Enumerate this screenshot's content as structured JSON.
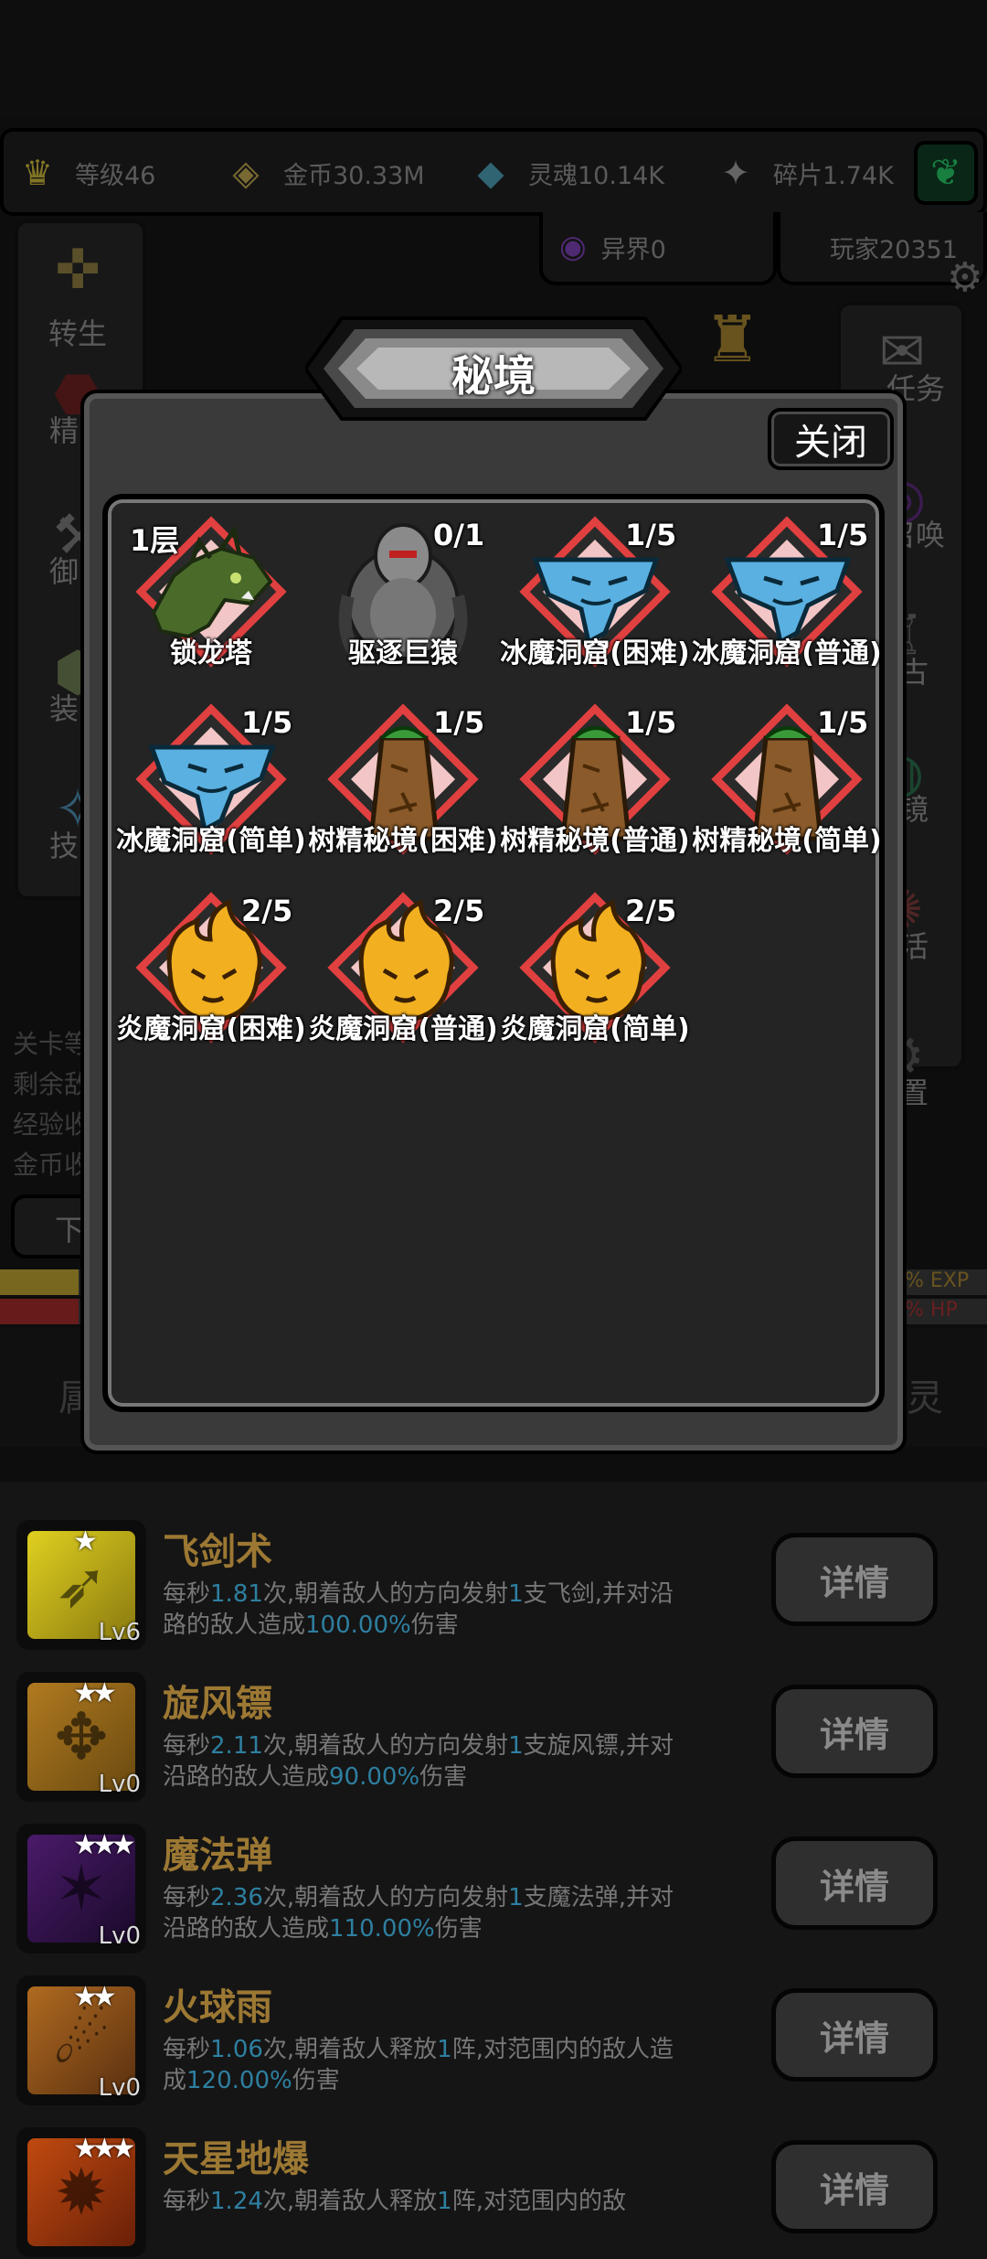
{
  "resources": [
    {
      "icon": "crown-icon",
      "text": "等级46"
    },
    {
      "icon": "coin-icon",
      "text": "金币30.33M"
    },
    {
      "icon": "soul-icon",
      "text": "灵魂10.14K"
    },
    {
      "icon": "fragment-icon",
      "text": "碎片1.74K"
    }
  ],
  "otherworld": "异界0",
  "player": "玩家20351",
  "left_menu": [
    "转生",
    "精",
    "御",
    "装",
    "技"
  ],
  "right_menu": [
    "任务",
    "召唤",
    "古",
    "镜",
    "活",
    "置"
  ],
  "bg_stats": [
    "关卡等",
    "剩余敌",
    "经验收",
    "金币收"
  ],
  "bg_button": "下",
  "bg_bars": {
    "exp": "% EXP",
    "hp": "% HP"
  },
  "bg_tabs": {
    "left": "属",
    "right": "灵"
  },
  "dialog": {
    "title": "秘境",
    "close_label": "关闭",
    "dungeons": [
      {
        "name": "锁龙塔",
        "count": "1层",
        "type": "dragon"
      },
      {
        "name": "驱逐巨猿",
        "count": "0/1",
        "type": "golem"
      },
      {
        "name": "冰魔洞窟(困难)",
        "count": "1/5",
        "type": "ice"
      },
      {
        "name": "冰魔洞窟(普通)",
        "count": "1/5",
        "type": "ice"
      },
      {
        "name": "冰魔洞窟(简单)",
        "count": "1/5",
        "type": "ice"
      },
      {
        "name": "树精秘境(困难)",
        "count": "1/5",
        "type": "tree"
      },
      {
        "name": "树精秘境(普通)",
        "count": "1/5",
        "type": "tree"
      },
      {
        "name": "树精秘境(简单)",
        "count": "1/5",
        "type": "tree"
      },
      {
        "name": "炎魔洞窟(困难)",
        "count": "2/5",
        "type": "fire"
      },
      {
        "name": "炎魔洞窟(普通)",
        "count": "2/5",
        "type": "fire"
      },
      {
        "name": "炎魔洞窟(简单)",
        "count": "2/5",
        "type": "fire"
      }
    ]
  },
  "skills": [
    {
      "name": "飞剑术",
      "level": "Lv6",
      "stars": "★",
      "detail": "详情",
      "desc": [
        [
          "每秒",
          false
        ],
        [
          "1.81",
          true
        ],
        [
          "次,朝着敌人的方向发射",
          false
        ],
        [
          "1",
          true
        ],
        [
          "支飞剑,并对沿路的敌人造成",
          false
        ],
        [
          "100.00%",
          true
        ],
        [
          "伤害",
          false
        ]
      ]
    },
    {
      "name": "旋风镖",
      "level": "Lv0",
      "stars": "★★",
      "detail": "详情",
      "desc": [
        [
          "每秒",
          false
        ],
        [
          "2.11",
          true
        ],
        [
          "次,朝着敌人的方向发射",
          false
        ],
        [
          "1",
          true
        ],
        [
          "支旋风镖,并对沿路的敌人造成",
          false
        ],
        [
          "90.00%",
          true
        ],
        [
          "伤害",
          false
        ]
      ]
    },
    {
      "name": "魔法弹",
      "level": "Lv0",
      "stars": "★★★",
      "detail": "详情",
      "desc": [
        [
          "每秒",
          false
        ],
        [
          "2.36",
          true
        ],
        [
          "次,朝着敌人的方向发射",
          false
        ],
        [
          "1",
          true
        ],
        [
          "支魔法弹,并对沿路的敌人造成",
          false
        ],
        [
          "110.00%",
          true
        ],
        [
          "伤害",
          false
        ]
      ]
    },
    {
      "name": "火球雨",
      "level": "Lv0",
      "stars": "★★",
      "detail": "详情",
      "desc": [
        [
          "每秒",
          false
        ],
        [
          "1.06",
          true
        ],
        [
          "次,朝着敌人释放",
          false
        ],
        [
          "1",
          true
        ],
        [
          "阵,对范围内的敌人造成",
          false
        ],
        [
          "120.00%",
          true
        ],
        [
          "伤害",
          false
        ]
      ]
    },
    {
      "name": "天星地爆",
      "level": "",
      "stars": "★★★",
      "detail": "详情",
      "desc": [
        [
          "每秒",
          false
        ],
        [
          "1.24",
          true
        ],
        [
          "次,朝着敌人释放",
          false
        ],
        [
          "1",
          true
        ],
        [
          "阵,对范围内的敌",
          false
        ]
      ]
    }
  ],
  "colors": {
    "highlight": "#2e7fa0",
    "skill_name": "#9c7833",
    "panel": "#242424"
  }
}
